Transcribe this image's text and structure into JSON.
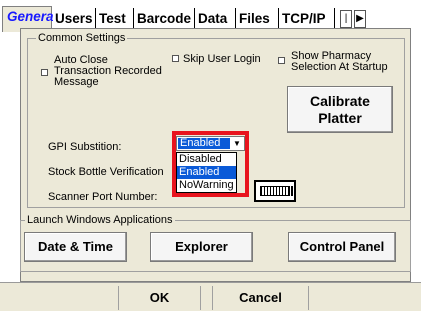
{
  "tabs": [
    {
      "label": "General",
      "active": true
    },
    {
      "label": "Users"
    },
    {
      "label": "Test"
    },
    {
      "label": "Barcode"
    },
    {
      "label": "Data"
    },
    {
      "label": "Files"
    },
    {
      "label": "TCP/IP"
    }
  ],
  "tab_scroll": {
    "first_icon": "scroll-first-icon",
    "next_icon": "scroll-next-icon"
  },
  "common_settings": {
    "title": "Common Settings",
    "auto_close_label": "Auto Close\nTransaction Recorded\nMessage",
    "skip_login_label": "Skip User Login",
    "show_pharmacy_label": "Show Pharmacy\nSelection At Startup",
    "calibrate_label": "Calibrate\nPlatter",
    "gpi_label": "GPI Substition:",
    "stock_bottle_label": "Stock Bottle Verification",
    "scanner_port_label": "Scanner Port Number:"
  },
  "gpi_combo": {
    "value": "Enabled",
    "options": [
      "Disabled",
      "Enabled",
      "NoWarning"
    ],
    "selected_index": 1
  },
  "launch": {
    "title": "Launch Windows Applications",
    "date_time": "Date & Time",
    "explorer": "Explorer",
    "control_panel": "Control Panel"
  },
  "footer": {
    "ok": "OK",
    "cancel": "Cancel"
  },
  "colors": {
    "tab_active": "#1a1aff",
    "highlight": "#0a5ad8",
    "annotation": "#e8141e",
    "panel": "#ece9d8"
  }
}
